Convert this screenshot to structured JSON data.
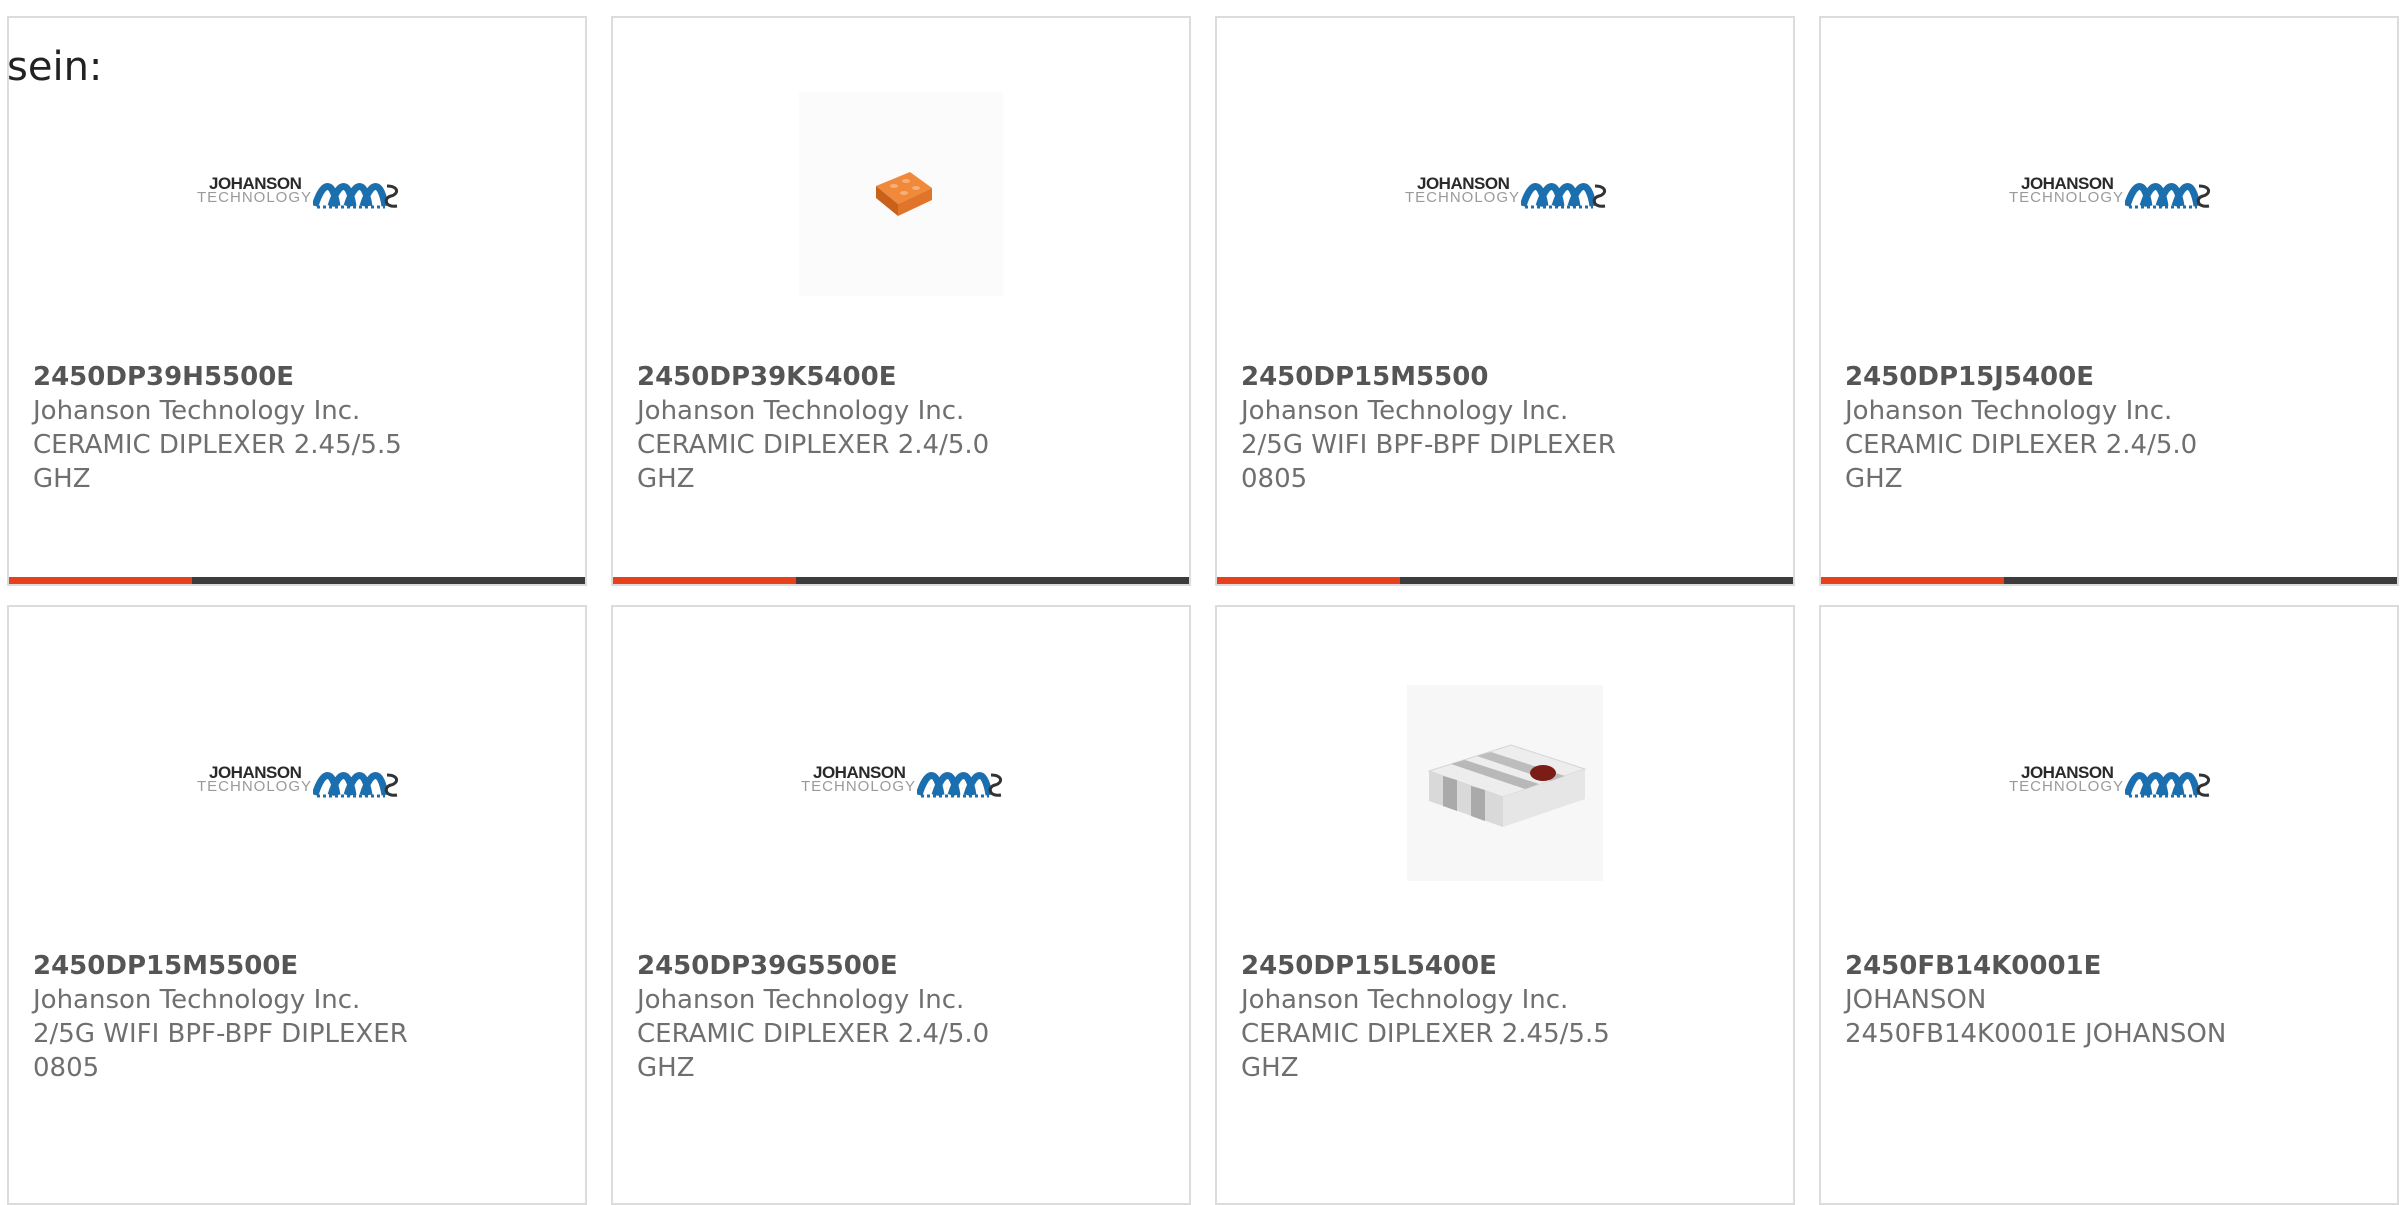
{
  "prefix_text": "sein:",
  "colors": {
    "accent": "#e8401c",
    "bar": "#3c3c3c",
    "border": "#dcdcdc"
  },
  "logo": {
    "line1": "JOHANSON",
    "line2": "TECHNOLOGY"
  },
  "products": [
    {
      "part": "2450DP39H5500E",
      "maker": "Johanson Technology Inc.",
      "desc": "CERAMIC DIPLEXER 2.45/5.5 GHZ",
      "image": "johanson-logo"
    },
    {
      "part": "2450DP39K5400E",
      "maker": "Johanson Technology Inc.",
      "desc": "CERAMIC DIPLEXER 2.4/5.0 GHZ",
      "image": "orange-chip"
    },
    {
      "part": "2450DP15M5500",
      "maker": "Johanson Technology Inc.",
      "desc": "2/5G WIFI BPF-BPF DIPLEXER 0805",
      "image": "johanson-logo"
    },
    {
      "part": "2450DP15J5400E",
      "maker": "Johanson Technology Inc.",
      "desc": "CERAMIC DIPLEXER 2.4/5.0 GHZ",
      "image": "johanson-logo"
    },
    {
      "part": "2450DP15M5500E",
      "maker": "Johanson Technology Inc.",
      "desc": "2/5G WIFI BPF-BPF DIPLEXER 0805",
      "image": "johanson-logo"
    },
    {
      "part": "2450DP39G5500E",
      "maker": "Johanson Technology Inc.",
      "desc": "CERAMIC DIPLEXER 2.4/5.0 GHZ",
      "image": "johanson-logo"
    },
    {
      "part": "2450DP15L5400E",
      "maker": "Johanson Technology Inc.",
      "desc": "CERAMIC DIPLEXER 2.45/5.5 GHZ",
      "image": "white-chip"
    },
    {
      "part": "2450FB14K0001E",
      "maker": "JOHANSON",
      "desc": "2450FB14K0001E JOHANSON",
      "image": "johanson-logo"
    }
  ]
}
